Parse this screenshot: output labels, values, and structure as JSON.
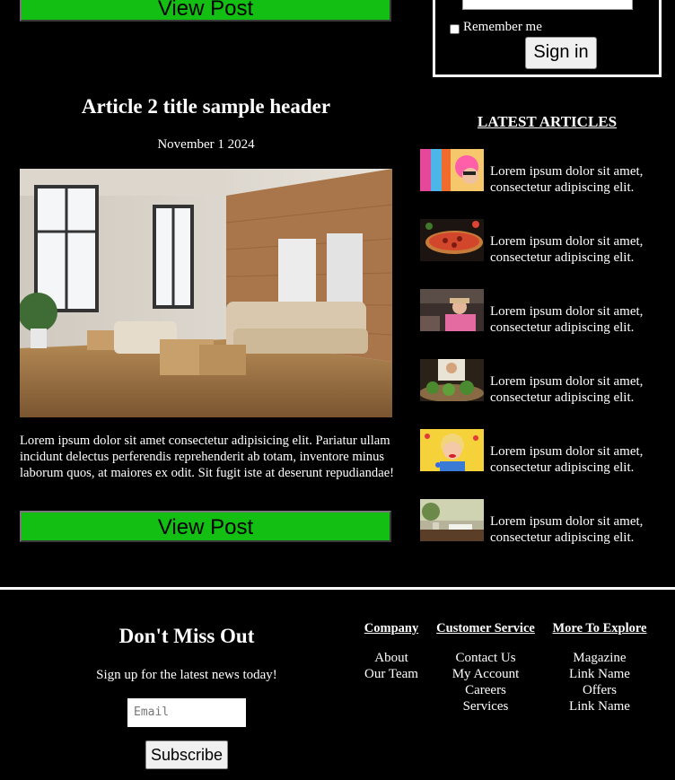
{
  "top_post": {
    "button_label": "View Post"
  },
  "login": {
    "remember_label": "Remember me",
    "signin_label": "Sign in"
  },
  "article": {
    "title": "Article 2 title sample header",
    "date": "November 1 2024",
    "excerpt": "Lorem ipsum dolor sit amet consectetur adipisicing elit. Pariatur ullam incidunt delectus perferendis reprehenderit ab totam, inventore minus laborum quos, at maiores ex odit. Sit fugit iste at deserunt repudiandae!",
    "button_label": "View Post"
  },
  "sidebar": {
    "heading": "LATEST ARTICLES",
    "items": [
      {
        "text": "Lorem ipsum dolor sit amet, consectetur adipiscing elit.",
        "thumb": "colorful-portrait"
      },
      {
        "text": "Lorem ipsum dolor sit amet, consectetur adipiscing elit.",
        "thumb": "pizza"
      },
      {
        "text": "Lorem ipsum dolor sit amet, consectetur adipiscing elit.",
        "thumb": "car-portrait"
      },
      {
        "text": "Lorem ipsum dolor sit amet, consectetur adipiscing elit.",
        "thumb": "chef-herbs"
      },
      {
        "text": "Lorem ipsum dolor sit amet, consectetur adipiscing elit.",
        "thumb": "pop-art"
      },
      {
        "text": "Lorem ipsum dolor sit amet, consectetur adipiscing elit.",
        "thumb": "cafe-table"
      }
    ]
  },
  "footer": {
    "heading": "Don't Miss Out",
    "subheading": "Sign up for the latest news today!",
    "email_placeholder": "Email",
    "subscribe_label": "Subscribe",
    "columns": [
      {
        "heading": "Company",
        "links": [
          "About",
          "Our Team"
        ]
      },
      {
        "heading": "Customer Service",
        "links": [
          "Contact Us",
          "My Account",
          "Careers",
          "Services"
        ]
      },
      {
        "heading": "More To Explore",
        "links": [
          "Magazine",
          "Link Name",
          "Offers",
          "Link Name"
        ]
      }
    ]
  },
  "colors": {
    "background": "#000000",
    "accent_green": "#12bf12",
    "text": "#ffffff"
  }
}
